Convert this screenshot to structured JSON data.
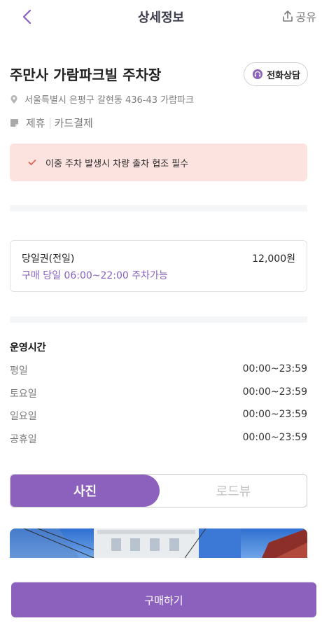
{
  "header": {
    "title": "상세정보",
    "share_label": "공유",
    "icons": {
      "back": "chevron-left-icon",
      "share": "share-upload-icon"
    }
  },
  "place": {
    "name": "주만사 가람파크빌 주차장",
    "call_label": "전화상담",
    "address": "서울특별시 은평구 갈현동 436-43 가람파크",
    "tags": [
      "제휴",
      "카드결제"
    ],
    "icons": {
      "call": "headset-icon",
      "address": "location-pin-icon",
      "tags": "tag-icon"
    }
  },
  "notice": {
    "text": "이중 주차 발생시 차량 출차 협조 필수",
    "icon": "check-icon"
  },
  "ticket": {
    "name": "당일권(전일)",
    "price": "12,000원",
    "description": "구매 당일 06:00~22:00 주차가능"
  },
  "hours": {
    "title": "운영시간",
    "rows": [
      {
        "day": "평일",
        "time": "00:00~23:59"
      },
      {
        "day": "토요일",
        "time": "00:00~23:59"
      },
      {
        "day": "일요일",
        "time": "00:00~23:59"
      },
      {
        "day": "공휴일",
        "time": "00:00~23:59"
      }
    ]
  },
  "media_tabs": {
    "photo_label": "사진",
    "roadview_label": "로드뷰",
    "selected": "사진"
  },
  "purchase": {
    "button_label": "구매하기"
  },
  "colors": {
    "accent": "#8c60bd",
    "notice_bg": "#fde3df",
    "muted_text": "#7b7b7b"
  }
}
